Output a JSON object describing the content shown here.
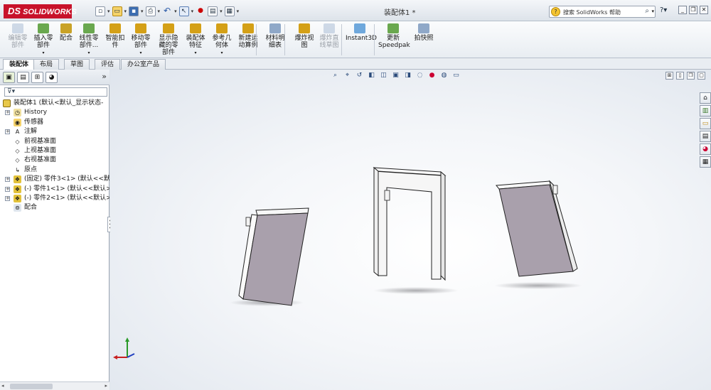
{
  "app": {
    "logo_text": "SOLIDWORKS",
    "logo_prefix": "DS",
    "document_title": "装配体1 *"
  },
  "search": {
    "placeholder": "搜索 SolidWorks 帮助"
  },
  "command_manager": {
    "items": [
      {
        "label_1": "编辑零",
        "label_2": "部件",
        "icon": "edit-component-icon",
        "enabled": false
      },
      {
        "label_1": "插入零",
        "label_2": "部件",
        "icon": "insert-components-icon",
        "enabled": true,
        "dropdown": true
      },
      {
        "label_1": "配合",
        "label_2": "",
        "icon": "mate-icon",
        "enabled": true
      },
      {
        "label_1": "线性零",
        "label_2": "部件...",
        "icon": "linear-pattern-icon",
        "enabled": true,
        "dropdown": true
      },
      {
        "label_1": "智能扣",
        "label_2": "件",
        "icon": "smart-fasteners-icon",
        "enabled": true
      },
      {
        "label_1": "移动零",
        "label_2": "部件",
        "icon": "move-component-icon",
        "enabled": true,
        "dropdown": true
      },
      {
        "label_1": "显示隐",
        "label_2": "藏的零",
        "label_3": "部件",
        "icon": "show-hidden-icon",
        "enabled": true
      },
      {
        "label_1": "装配体",
        "label_2": "特征",
        "icon": "assembly-features-icon",
        "enabled": true,
        "dropdown": true
      },
      {
        "label_1": "参考几",
        "label_2": "何体",
        "icon": "reference-geometry-icon",
        "enabled": true,
        "dropdown": true
      },
      {
        "label_1": "新建运",
        "label_2": "动算例",
        "icon": "new-motion-study-icon",
        "enabled": true
      },
      {
        "label_1": "材料明",
        "label_2": "细表",
        "icon": "bom-icon",
        "enabled": true
      },
      {
        "label_1": "爆炸视",
        "label_2": "图",
        "icon": "exploded-view-icon",
        "enabled": true
      },
      {
        "label_1": "爆炸直",
        "label_2": "线草图",
        "icon": "explode-line-sketch-icon",
        "enabled": false
      },
      {
        "label_1": "Instant3D",
        "label_2": "",
        "icon": "instant3d-icon",
        "enabled": true
      },
      {
        "label_1": "更新",
        "label_2": "Speedpak",
        "icon": "speedpak-icon",
        "enabled": true
      },
      {
        "label_1": "拍快照",
        "label_2": "",
        "icon": "snapshot-icon",
        "enabled": true
      }
    ]
  },
  "tabs": [
    {
      "label": "装配体",
      "active": true
    },
    {
      "label": "布局",
      "active": false
    },
    {
      "label": "草图",
      "active": false
    },
    {
      "label": "评估",
      "active": false
    },
    {
      "label": "办公室产品",
      "active": false
    }
  ],
  "feature_tree": {
    "root": "装配体1 (默认<默认_显示状态-",
    "nodes": [
      {
        "label": "History",
        "icon": "history-icon",
        "expandable": true
      },
      {
        "label": "传感器",
        "icon": "sensor-icon",
        "expandable": false
      },
      {
        "label": "注解",
        "icon": "annotations-icon",
        "expandable": true
      },
      {
        "label": "前视基准面",
        "icon": "plane-icon",
        "expandable": false
      },
      {
        "label": "上视基准面",
        "icon": "plane-icon",
        "expandable": false
      },
      {
        "label": "右视基准面",
        "icon": "plane-icon",
        "expandable": false
      },
      {
        "label": "原点",
        "icon": "origin-icon",
        "expandable": false
      },
      {
        "label": "(固定) 零件3<1> (默认<<默",
        "icon": "part-icon",
        "expandable": true
      },
      {
        "label": "(-) 零件1<1> (默认<<默认>",
        "icon": "part-icon",
        "expandable": true
      },
      {
        "label": "(-) 零件2<1> (默认<<默认>",
        "icon": "part-icon",
        "expandable": true
      },
      {
        "label": "配合",
        "icon": "mates-folder-icon",
        "expandable": false
      }
    ]
  },
  "colors": {
    "logo_red": "#c8122a",
    "door_panel": "#a9a0ac",
    "frame": "#f4f4f4"
  }
}
